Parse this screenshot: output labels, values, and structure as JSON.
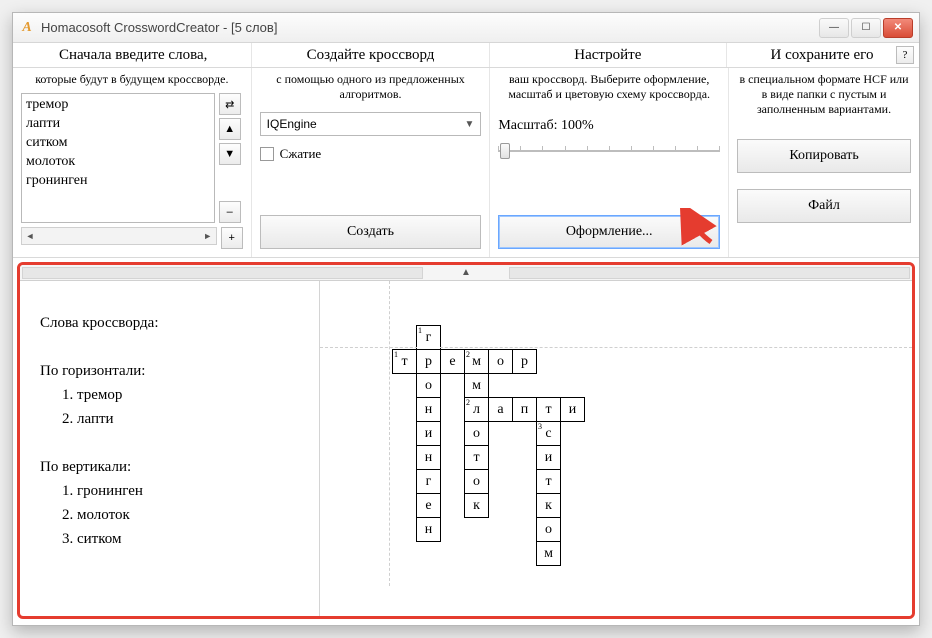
{
  "window": {
    "title": "Homacosoft CrosswordCreator - [5 слов]"
  },
  "steps": {
    "s1": "Сначала введите слова,",
    "s2": "Создайте кроссворд",
    "s3": "Настройте",
    "s4": "И сохраните его",
    "help": "?"
  },
  "panel1": {
    "sub": "которые будут в будущем кроссворде.",
    "words": [
      "тремор",
      "лапти",
      "ситком",
      "молоток",
      "гронинген"
    ],
    "btns": {
      "swap": "⇄",
      "up": "▲",
      "down": "▼",
      "minus": "–",
      "plus": "+"
    }
  },
  "panel2": {
    "sub": "с помощью одного из предложенных алгоритмов.",
    "engine": "IQEngine",
    "compress": "Сжатие",
    "create": "Создать"
  },
  "panel3": {
    "sub": "ваш кроссворд. Выберите оформление, масштаб и цветовую схему кроссворда.",
    "zoom_label": "Масштаб:",
    "zoom_val": "100%",
    "design": "Оформление..."
  },
  "panel4": {
    "sub": "в специальном формате HCF или в виде папки с пустым и заполненным вариантами.",
    "copy": "Копировать",
    "file": "Файл"
  },
  "clues": {
    "title": "Слова кроссворда:",
    "across_head": "По горизонтали:",
    "across": [
      "1. тремор",
      "2. лапти"
    ],
    "down_head": "По вертикали:",
    "down": [
      "1. гронинген",
      "2. молоток",
      "3. ситком"
    ]
  },
  "grid": {
    "rows": [
      [
        null,
        "г",
        null,
        null,
        null,
        null,
        null,
        null
      ],
      [
        "т",
        "р",
        "е",
        "м",
        "о",
        "р",
        null,
        null
      ],
      [
        null,
        "о",
        null,
        "м",
        null,
        null,
        null,
        null
      ],
      [
        null,
        "н",
        null,
        "л",
        "а",
        "п",
        "т",
        "и"
      ],
      [
        null,
        "и",
        null,
        "о",
        null,
        null,
        "с",
        null
      ],
      [
        null,
        "н",
        null,
        "т",
        null,
        null,
        "и",
        null
      ],
      [
        null,
        "г",
        null,
        "о",
        null,
        null,
        "т",
        null
      ],
      [
        null,
        "е",
        null,
        "к",
        null,
        null,
        "к",
        null
      ],
      [
        null,
        "н",
        null,
        null,
        null,
        null,
        "о",
        null
      ],
      [
        null,
        null,
        null,
        null,
        null,
        null,
        "м",
        null
      ]
    ],
    "nums": {
      "0,1": "1",
      "1,0": "1",
      "1,3": "2",
      "3,3": "2",
      "4,6": "3"
    }
  }
}
